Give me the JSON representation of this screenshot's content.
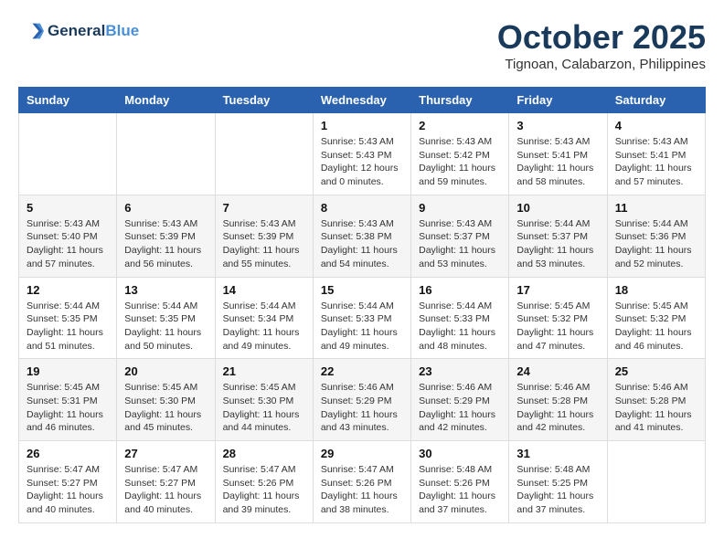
{
  "header": {
    "logo_line1": "General",
    "logo_line2": "Blue",
    "month_title": "October 2025",
    "location": "Tignoan, Calabarzon, Philippines"
  },
  "weekdays": [
    "Sunday",
    "Monday",
    "Tuesday",
    "Wednesday",
    "Thursday",
    "Friday",
    "Saturday"
  ],
  "weeks": [
    [
      {
        "day": "",
        "info": ""
      },
      {
        "day": "",
        "info": ""
      },
      {
        "day": "",
        "info": ""
      },
      {
        "day": "1",
        "info": "Sunrise: 5:43 AM\nSunset: 5:43 PM\nDaylight: 12 hours\nand 0 minutes."
      },
      {
        "day": "2",
        "info": "Sunrise: 5:43 AM\nSunset: 5:42 PM\nDaylight: 11 hours\nand 59 minutes."
      },
      {
        "day": "3",
        "info": "Sunrise: 5:43 AM\nSunset: 5:41 PM\nDaylight: 11 hours\nand 58 minutes."
      },
      {
        "day": "4",
        "info": "Sunrise: 5:43 AM\nSunset: 5:41 PM\nDaylight: 11 hours\nand 57 minutes."
      }
    ],
    [
      {
        "day": "5",
        "info": "Sunrise: 5:43 AM\nSunset: 5:40 PM\nDaylight: 11 hours\nand 57 minutes."
      },
      {
        "day": "6",
        "info": "Sunrise: 5:43 AM\nSunset: 5:39 PM\nDaylight: 11 hours\nand 56 minutes."
      },
      {
        "day": "7",
        "info": "Sunrise: 5:43 AM\nSunset: 5:39 PM\nDaylight: 11 hours\nand 55 minutes."
      },
      {
        "day": "8",
        "info": "Sunrise: 5:43 AM\nSunset: 5:38 PM\nDaylight: 11 hours\nand 54 minutes."
      },
      {
        "day": "9",
        "info": "Sunrise: 5:43 AM\nSunset: 5:37 PM\nDaylight: 11 hours\nand 53 minutes."
      },
      {
        "day": "10",
        "info": "Sunrise: 5:44 AM\nSunset: 5:37 PM\nDaylight: 11 hours\nand 53 minutes."
      },
      {
        "day": "11",
        "info": "Sunrise: 5:44 AM\nSunset: 5:36 PM\nDaylight: 11 hours\nand 52 minutes."
      }
    ],
    [
      {
        "day": "12",
        "info": "Sunrise: 5:44 AM\nSunset: 5:35 PM\nDaylight: 11 hours\nand 51 minutes."
      },
      {
        "day": "13",
        "info": "Sunrise: 5:44 AM\nSunset: 5:35 PM\nDaylight: 11 hours\nand 50 minutes."
      },
      {
        "day": "14",
        "info": "Sunrise: 5:44 AM\nSunset: 5:34 PM\nDaylight: 11 hours\nand 49 minutes."
      },
      {
        "day": "15",
        "info": "Sunrise: 5:44 AM\nSunset: 5:33 PM\nDaylight: 11 hours\nand 49 minutes."
      },
      {
        "day": "16",
        "info": "Sunrise: 5:44 AM\nSunset: 5:33 PM\nDaylight: 11 hours\nand 48 minutes."
      },
      {
        "day": "17",
        "info": "Sunrise: 5:45 AM\nSunset: 5:32 PM\nDaylight: 11 hours\nand 47 minutes."
      },
      {
        "day": "18",
        "info": "Sunrise: 5:45 AM\nSunset: 5:32 PM\nDaylight: 11 hours\nand 46 minutes."
      }
    ],
    [
      {
        "day": "19",
        "info": "Sunrise: 5:45 AM\nSunset: 5:31 PM\nDaylight: 11 hours\nand 46 minutes."
      },
      {
        "day": "20",
        "info": "Sunrise: 5:45 AM\nSunset: 5:30 PM\nDaylight: 11 hours\nand 45 minutes."
      },
      {
        "day": "21",
        "info": "Sunrise: 5:45 AM\nSunset: 5:30 PM\nDaylight: 11 hours\nand 44 minutes."
      },
      {
        "day": "22",
        "info": "Sunrise: 5:46 AM\nSunset: 5:29 PM\nDaylight: 11 hours\nand 43 minutes."
      },
      {
        "day": "23",
        "info": "Sunrise: 5:46 AM\nSunset: 5:29 PM\nDaylight: 11 hours\nand 42 minutes."
      },
      {
        "day": "24",
        "info": "Sunrise: 5:46 AM\nSunset: 5:28 PM\nDaylight: 11 hours\nand 42 minutes."
      },
      {
        "day": "25",
        "info": "Sunrise: 5:46 AM\nSunset: 5:28 PM\nDaylight: 11 hours\nand 41 minutes."
      }
    ],
    [
      {
        "day": "26",
        "info": "Sunrise: 5:47 AM\nSunset: 5:27 PM\nDaylight: 11 hours\nand 40 minutes."
      },
      {
        "day": "27",
        "info": "Sunrise: 5:47 AM\nSunset: 5:27 PM\nDaylight: 11 hours\nand 40 minutes."
      },
      {
        "day": "28",
        "info": "Sunrise: 5:47 AM\nSunset: 5:26 PM\nDaylight: 11 hours\nand 39 minutes."
      },
      {
        "day": "29",
        "info": "Sunrise: 5:47 AM\nSunset: 5:26 PM\nDaylight: 11 hours\nand 38 minutes."
      },
      {
        "day": "30",
        "info": "Sunrise: 5:48 AM\nSunset: 5:26 PM\nDaylight: 11 hours\nand 37 minutes."
      },
      {
        "day": "31",
        "info": "Sunrise: 5:48 AM\nSunset: 5:25 PM\nDaylight: 11 hours\nand 37 minutes."
      },
      {
        "day": "",
        "info": ""
      }
    ]
  ]
}
